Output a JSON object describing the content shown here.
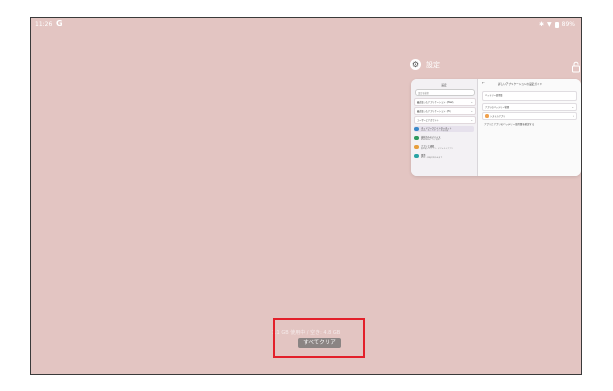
{
  "status_bar": {
    "time": "11:26",
    "google_logo": "G",
    "battery": "89%"
  },
  "recent_app": {
    "name": "設定",
    "icon": "gear-icon",
    "card": {
      "left_title": "設定",
      "search_placeholder": "設定を検索",
      "expandable_rows": [
        "最近使ったアプリケーション（Pixel）",
        "最近使ったアプリケーション（Hi）",
        "ユーザーとアカウント"
      ],
      "app_items": [
        {
          "title": "ネットワークとインターネット",
          "sub": "Wi-Fi、モバイル、データ使用量",
          "color": "#3a88c9",
          "selected": true
        },
        {
          "title": "接続済みのデバイス",
          "sub": "Bluetooth、ペア設定",
          "color": "#2f9a5d",
          "selected": false
        },
        {
          "title": "アプリと通知",
          "sub": "最近使ったアプリ、デフォルトアプリ",
          "color": "#e79e3c",
          "selected": false
        },
        {
          "title": "電池",
          "sub": "89% - 充電が終わるまで",
          "color": "#29a3a3",
          "selected": false
        }
      ],
      "right_title": "詳しいアプリケーションの設定ガイド",
      "right_blocks": [
        "バッテリー使用量",
        "アプリのバッテリー管理",
        "システムアプリ"
      ],
      "right_note": "アプリとアプリのバッテリー使用量を確認する"
    }
  },
  "recent_info": "1.1 GB 使用中 / 空き: 4.8 GB",
  "clear_all_label": "すべてクリア",
  "colors": {
    "wallpaper": "#e3c5c2",
    "highlight": "#e3202a",
    "button_bg": "#8a8483"
  }
}
